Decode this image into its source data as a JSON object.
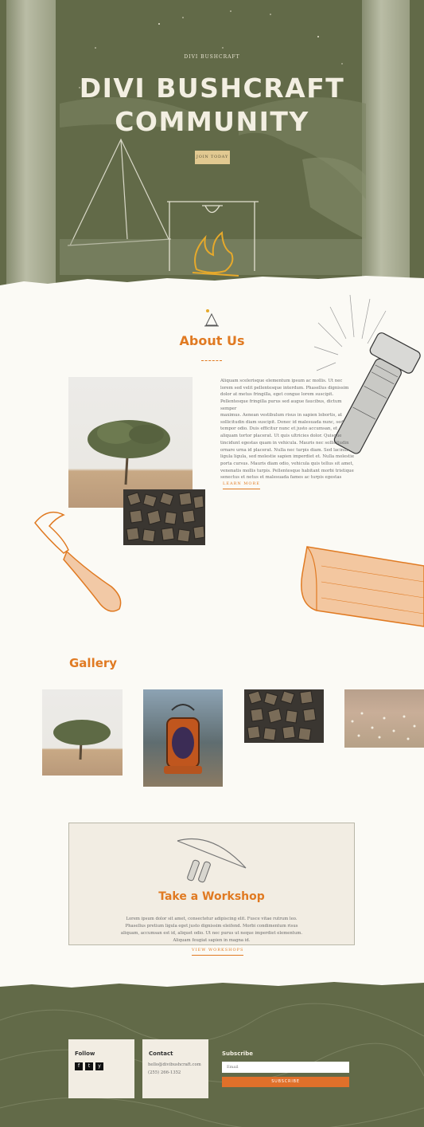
{
  "hero": {
    "eyebrow": "DIVI BUSHCRAFT",
    "title_line1": "DIVI BUSHCRAFT",
    "title_line2": "COMMUNITY",
    "cta_label": "JOIN TODAY"
  },
  "about": {
    "heading": "About Us",
    "paragraph1": "Aliquam scelerisque elementum ipsum ac mollis. Ut nec lorem sed velit pellentesque interdum. Phasellus dignissim dolor at metus fringilla, eget congue lorem suscipit. Pellentesque fringilla purus sed augue faucibus, dictum semper",
    "paragraph2": "maximus. Aenean vestibulum risus in sapien lobortis, at sollicitudin diam suscipit. Donec id malesuada nunc, sed tempor odio. Duis efficitur nunc et justo accumsan, et aliquam tortor placerat. Ut quis ultricies dolor. Quisque tincidunt egestas quam in vehicula. Mauris nec sollicitudin ornare urna id placerat. Nulla nec turpis diam. Sed lacinia ligula ligula, sed molestie sapien imperdiet et. Nulla molestie porta cursus. Mauris diam odio, vehicula quis tellus sit amet, venenatis mollis turpis. Pellentesque habitant morbi tristique senectus et netus et malesuada fames ac turpis egestas",
    "link_label": "LEARN MORE"
  },
  "gallery": {
    "heading": "Gallery"
  },
  "workshop": {
    "heading": "Take a Workshop",
    "body": "Lorem ipsum dolor sit amet, consectetur adipiscing elit. Fusce vitae rutrum leo. Phasellus pretium ligula eget justo dignissim eleifend. Morbi condimentum risus aliquam, accumsan est id, aliquet odio. Ut nec purus ut neque imperdiet elementum. Aliquam feugiat sapien in magna id.",
    "link_label": "VIEW WORKSHOPS"
  },
  "footer": {
    "follow_heading": "Follow",
    "social": [
      "f",
      "t",
      "y"
    ],
    "contact_heading": "Contact",
    "contact_email": "hello@divibushcraft.com",
    "contact_phone": "(255) 266-1352",
    "subscribe_heading": "Subscribe",
    "email_placeholder": "Email",
    "subscribe_label": "SUBSCRIBE"
  },
  "colors": {
    "olive": "#626a48",
    "accent": "#e07a22",
    "cream": "#fbfaf5",
    "card": "#f2ede3",
    "button": "#e1c991"
  }
}
